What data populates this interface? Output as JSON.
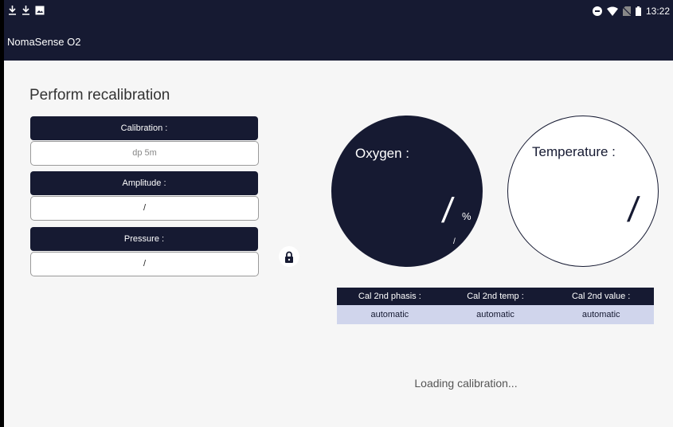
{
  "status_bar": {
    "left_icons": [
      "download-icon",
      "download-icon",
      "image-icon"
    ],
    "right_icons": [
      "do-not-disturb-icon",
      "wifi-icon",
      "no-sim-icon",
      "battery-icon"
    ],
    "time": "13:22"
  },
  "app": {
    "title": "NomaSense O2"
  },
  "page": {
    "title": "Perform recalibration"
  },
  "fields": {
    "calibration": {
      "label": "Calibration :",
      "value": "dp 5m"
    },
    "amplitude": {
      "label": "Amplitude :",
      "value": "/"
    },
    "pressure": {
      "label": "Pressure :",
      "value": "/"
    }
  },
  "lock": {
    "icon": "lock-icon"
  },
  "gauges": {
    "oxygen": {
      "label": "Oxygen :",
      "value": "/",
      "unit": "%",
      "sub_value": "/"
    },
    "temperature": {
      "label": "Temperature :",
      "value": "/"
    }
  },
  "cal_table": {
    "headers": [
      "Cal 2nd phasis :",
      "Cal 2nd temp :",
      "Cal 2nd value :"
    ],
    "values": [
      "automatic",
      "automatic",
      "automatic"
    ]
  },
  "loading_text": "Loading calibration...",
  "colors": {
    "primary": "#161a32",
    "table_row": "#d0d5ec",
    "background": "#f6f6f6"
  }
}
